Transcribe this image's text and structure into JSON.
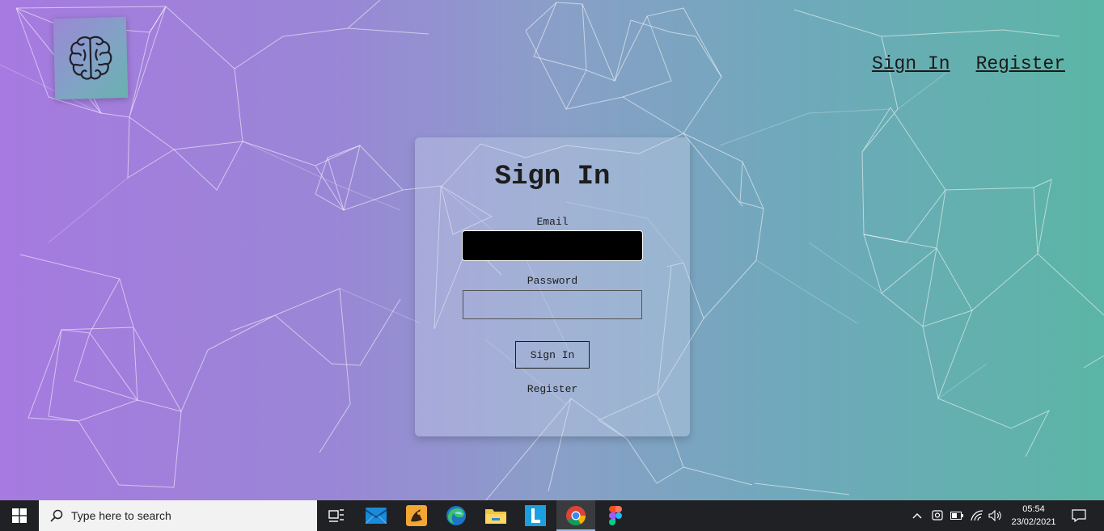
{
  "header": {
    "nav": {
      "sign_in": "Sign In",
      "register": "Register"
    },
    "logo_icon": "brain-icon"
  },
  "card": {
    "title": "Sign In",
    "email_label": "Email",
    "email_value": "",
    "password_label": "Password",
    "password_value": "",
    "submit_label": "Sign In",
    "register_label": "Register"
  },
  "taskbar": {
    "search_placeholder": "Type here to search",
    "apps": [
      "start-icon",
      "task-view-icon",
      "mail-icon",
      "app-icon",
      "edge-icon",
      "file-explorer-icon",
      "l-app-icon",
      "chrome-icon",
      "figma-icon"
    ],
    "tray": [
      "chevron-up-icon",
      "webcam-icon",
      "battery-icon",
      "wifi-icon",
      "volume-icon",
      "notification-icon"
    ],
    "time": "05:54",
    "date": "23/02/2021"
  },
  "colors": {
    "gradient_left": "#a67ae0",
    "gradient_right": "#5bb5a5",
    "taskbar": "#202124"
  }
}
